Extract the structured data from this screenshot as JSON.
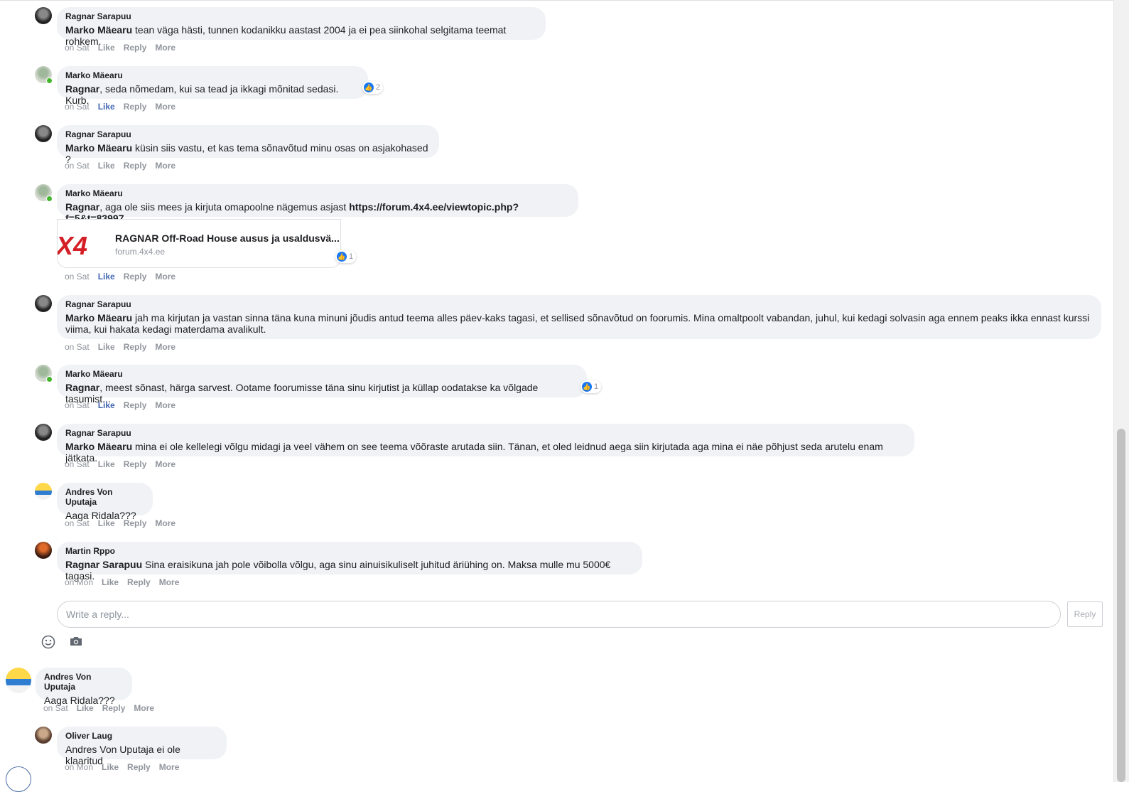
{
  "comments": [
    {
      "author": "Ragnar Sarapuu",
      "mention": "Marko Mäearu",
      "text": " tean väga hästi, tunnen kodanikku aastast 2004 ja ei pea siinkohal selgitama teemat rohkem.",
      "time": "on Sat",
      "like": "Like",
      "reply": "Reply",
      "more": "More"
    },
    {
      "author": "Marko Mäearu",
      "mention": "Ragnar",
      "text": ", seda nõmedam, kui sa tead ja ikkagi mõnitad sedasi. Kurb.",
      "time": "on Sat",
      "like": "Like",
      "reply": "Reply",
      "more": "More",
      "reactions": "2"
    },
    {
      "author": "Ragnar Sarapuu",
      "mention": "Marko Mäearu",
      "text": " küsin siis vastu, et kas tema sõnavõtud minu osas on asjakohased ?",
      "time": "on Sat",
      "like": "Like",
      "reply": "Reply",
      "more": "More"
    },
    {
      "author": "Marko Mäearu",
      "mention": "Ragnar",
      "text": ", aga ole siis mees ja kirjuta omapoolne nägemus asjast ",
      "link": "https://forum.4x4.ee/viewtopic.php?f=5&t=83997",
      "time": "on Sat",
      "like": "Like",
      "reply": "Reply",
      "more": "More",
      "reactions": "1",
      "preview": {
        "title": "RAGNAR Off-Road House ausus ja usaldusvä...",
        "domain": "forum.4x4.ee",
        "logo_text": "X4"
      }
    },
    {
      "author": "Ragnar Sarapuu",
      "mention": "Marko Mäearu",
      "text": " jah ma kirjutan ja vastan sinna täna kuna minuni jõudis antud teema alles päev-kaks tagasi, et sellised sõnavõtud on foorumis. Mina omaltpoolt vabandan, juhul, kui kedagi solvasin aga ennem peaks ikka ennast kurssi viima, kui hakata kedagi materdama avalikult.",
      "time": "on Sat",
      "like": "Like",
      "reply": "Reply",
      "more": "More"
    },
    {
      "author": "Marko Mäearu",
      "mention": "Ragnar",
      "text": ", meest sõnast, härga sarvest. Ootame foorumisse täna sinu kirjutist ja küllap oodatakse ka võlgade tasumist...",
      "time": "on Sat",
      "like": "Like",
      "reply": "Reply",
      "more": "More",
      "reactions": "1"
    },
    {
      "author": "Ragnar Sarapuu",
      "mention": "Marko Mäearu",
      "text": " mina ei ole kellelegi võlgu midagi ja veel vähem on see teema võõraste arutada siin. Tänan, et oled leidnud aega siin kirjutada aga mina ei näe põhjust seda arutelu enam jätkata.",
      "time": "on Sat",
      "like": "Like",
      "reply": "Reply",
      "more": "More"
    },
    {
      "author": "Andres Von Uputaja",
      "mention": "",
      "text": "Aaga Ridala???",
      "time": "on Sat",
      "like": "Like",
      "reply": "Reply",
      "more": "More"
    },
    {
      "author": "Martin Rppo",
      "mention": "Ragnar Sarapuu",
      "text": " Sina eraisikuna jah pole võibolla võlgu, aga sinu ainuisikuliselt juhitud äriühing on. Maksa mulle mu 5000€ tagasi.",
      "time": "on Mon",
      "like": "Like",
      "reply": "Reply",
      "more": "More"
    }
  ],
  "reply_box": {
    "placeholder": "Write a reply...",
    "button": "Reply"
  },
  "top_comment": {
    "author": "Andres Von Uputaja",
    "text": "Aaga Ridala???",
    "time": "on Sat",
    "like": "Like",
    "reply": "Reply",
    "more": "More"
  },
  "last_comment": {
    "author": "Oliver Laug",
    "text": "Andres Von Uputaja ei ole klaaritud",
    "time": "on Mon",
    "like": "Like",
    "reply": "Reply",
    "more": "More"
  },
  "colors": {
    "bubble": "#f0f2f5",
    "link_blue": "#4267b2",
    "meta_gray": "#90949c",
    "online_green": "#42b72a"
  }
}
